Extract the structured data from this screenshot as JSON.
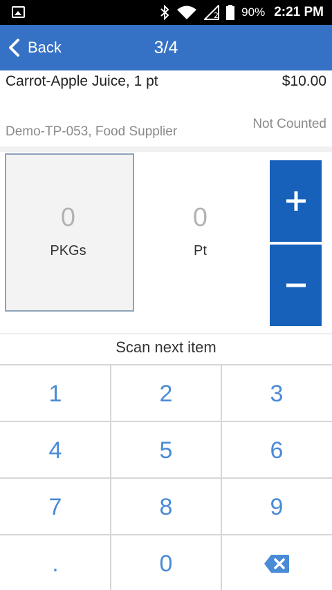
{
  "status_bar": {
    "battery_percent": "90%",
    "time": "2:21 PM"
  },
  "header": {
    "back_label": "Back",
    "page_count": "3/4"
  },
  "item": {
    "name": "Carrot-Apple Juice, 1 pt",
    "price": "$10.00",
    "supplier": "Demo-TP-053, Food Supplier",
    "count_status": "Not Counted"
  },
  "quantities": {
    "packages": {
      "value": "0",
      "unit": "PKGs"
    },
    "units": {
      "value": "0",
      "unit": "Pt"
    }
  },
  "scan_prompt": "Scan next item",
  "keypad": {
    "keys": [
      "1",
      "2",
      "3",
      "4",
      "5",
      "6",
      "7",
      "8",
      "9",
      ".",
      "0"
    ]
  },
  "colors": {
    "header_bg": "#3571c4",
    "stepper_bg": "#1761ba",
    "keypad_text": "#4a8bd6"
  },
  "icons": {
    "status_left": "gallery-icon",
    "status_right": [
      "bluetooth-icon",
      "wifi-icon",
      "signal-icon",
      "battery-icon"
    ],
    "back": "chevron-left-icon",
    "increment": "plus-icon",
    "decrement": "minus-icon",
    "delete": "backspace-icon"
  }
}
